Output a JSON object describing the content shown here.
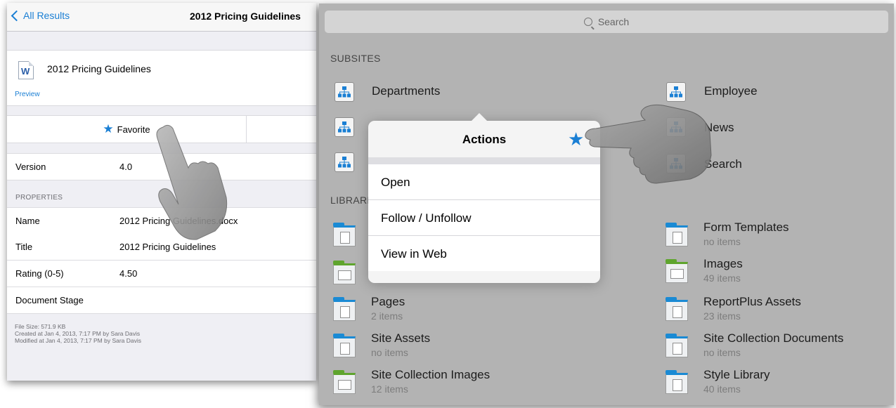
{
  "left_panel": {
    "nav": {
      "back_label": "All Results",
      "title": "2012 Pricing Guidelines"
    },
    "document": {
      "icon": "word-doc-icon",
      "icon_letter": "W",
      "title": "2012 Pricing Guidelines",
      "preview_label": "Preview"
    },
    "favorite": {
      "icon": "star-icon",
      "label": "Favorite"
    },
    "version": {
      "key": "Version",
      "value": "4.0"
    },
    "properties_header": "PROPERTIES",
    "properties": [
      {
        "key": "Name",
        "value": "2012 Pricing Guidelines.docx"
      },
      {
        "key": "Title",
        "value": "2012 Pricing Guidelines"
      },
      {
        "key": "Rating (0-5)",
        "value": "4.50"
      },
      {
        "key": "Document Stage",
        "value": ""
      }
    ],
    "footer": {
      "file_size": "File Size: 571.9 KB",
      "created": "Created at Jan 4, 2013, 7:17 PM by Sara Davis",
      "modified": "Modified at Jan 4, 2013, 7:17 PM by Sara Davis"
    }
  },
  "right_panel": {
    "search": {
      "placeholder": "Search",
      "icon": "search-icon"
    },
    "subsites_header": "SUBSITES",
    "subsites": [
      "Departments",
      "Employee",
      "News",
      "Search"
    ],
    "libraries_header": "LIBRARIES",
    "libraries": [
      {
        "name": "Form Templates",
        "count": "no items",
        "type": "doc",
        "color": "#1a8ad4"
      },
      {
        "name": "Images",
        "count": "49 items",
        "type": "image",
        "color": "#5fa52e"
      },
      {
        "name": "Pages",
        "count": "2 items",
        "type": "doc",
        "color": "#1a8ad4"
      },
      {
        "name": "ReportPlus Assets",
        "count": "23 items",
        "type": "doc",
        "color": "#1a8ad4"
      },
      {
        "name": "Site Assets",
        "count": "no items",
        "type": "doc",
        "color": "#1a8ad4"
      },
      {
        "name": "Site Collection Documents",
        "count": "no items",
        "type": "doc",
        "color": "#1a8ad4"
      },
      {
        "name": "Site Collection Images",
        "count": "12 items",
        "type": "image",
        "color": "#5fa52e"
      },
      {
        "name": "Style Library",
        "count": "40 items",
        "type": "doc",
        "color": "#1a8ad4"
      }
    ],
    "actions_popover": {
      "title": "Actions",
      "favorite_icon": "star-icon",
      "options": [
        "Open",
        "Follow / Unfollow",
        "View in Web"
      ]
    }
  },
  "colors": {
    "accent": "#1a7fd4",
    "doc_folder": "#1a8ad4",
    "image_folder": "#5fa52e"
  }
}
